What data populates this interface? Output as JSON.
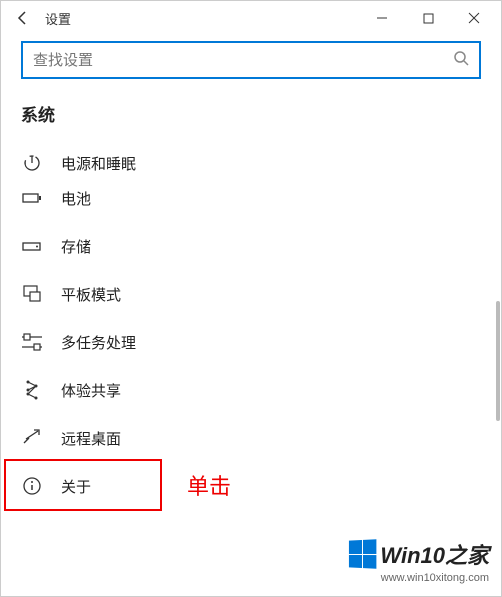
{
  "window": {
    "title": "设置"
  },
  "search": {
    "placeholder": "查找设置"
  },
  "section_title": "系统",
  "nav": {
    "items": [
      {
        "label": "电源和睡眠"
      },
      {
        "label": "电池"
      },
      {
        "label": "存储"
      },
      {
        "label": "平板模式"
      },
      {
        "label": "多任务处理"
      },
      {
        "label": "体验共享"
      },
      {
        "label": "远程桌面"
      },
      {
        "label": "关于"
      }
    ]
  },
  "annotation": "单击",
  "watermark": {
    "brand": "Win10之家",
    "url": "www.win10xitong.com"
  }
}
